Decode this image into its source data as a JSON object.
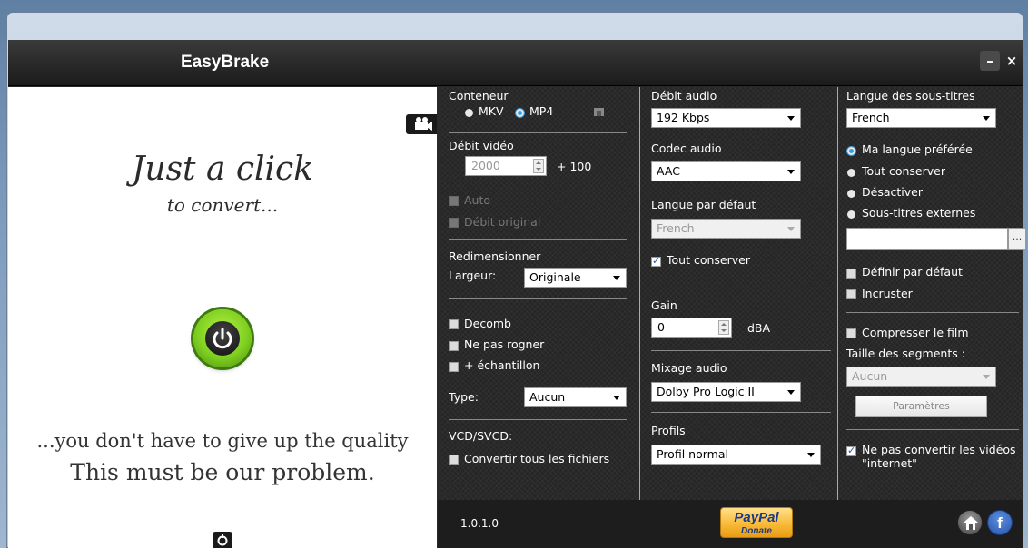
{
  "app": {
    "title": "EasyBrake",
    "minimize_label": "–",
    "close_label": "×"
  },
  "left": {
    "slogan_1": "Just a click",
    "slogan_2": "to convert...",
    "slogan_3": "...you don't have to give up the quality",
    "slogan_4": "This must be our problem."
  },
  "col1": {
    "container_label": "Conteneur",
    "container_options": [
      "MKV",
      "MP4"
    ],
    "container_selected": "MP4",
    "video_bitrate_label": "Débit vidéo",
    "video_bitrate_value": "2000",
    "video_bitrate_step": "+ 100",
    "auto_label": "Auto",
    "original_bitrate_label": "Débit original",
    "resize_label": "Redimensionner",
    "width_label": "Largeur:",
    "width_value": "Originale",
    "decomb_label": "Decomb",
    "no_crop_label": "Ne pas rogner",
    "sample_label": "+ échantillon",
    "type_label": "Type:",
    "type_value": "Aucun",
    "vcd_label": "VCD/SVCD:",
    "convert_all_label": "Convertir tous les fichiers"
  },
  "col2": {
    "audio_bitrate_label": "Débit audio",
    "audio_bitrate_value": "192 Kbps",
    "audio_codec_label": "Codec audio",
    "audio_codec_value": "AAC",
    "default_lang_label": "Langue par défaut",
    "default_lang_value": "French",
    "keep_all_label": "Tout conserver",
    "gain_label": "Gain",
    "gain_value": "0",
    "gain_unit": "dBA",
    "mixdown_label": "Mixage audio",
    "mixdown_value": "Dolby Pro Logic II",
    "profiles_label": "Profils",
    "profile_value": "Profil normal"
  },
  "col3": {
    "sub_lang_label": "Langue des sous-titres",
    "sub_lang_value": "French",
    "sub_options": [
      "Ma langue préférée",
      "Tout conserver",
      "Désactiver",
      "Sous-titres externes"
    ],
    "sub_selected": "Ma langue préférée",
    "browse_label": "...",
    "set_default_label": "Définir par défaut",
    "burn_in_label": "Incruster",
    "compress_label": "Compresser le film",
    "segment_size_label": "Taille des segments :",
    "segment_size_value": "Aucun",
    "params_label": "Paramètres",
    "no_convert_internet_label": "Ne pas convertir les vidéos \"internet\""
  },
  "footer": {
    "version": "1.0.1.0",
    "paypal_word": "PayPal",
    "paypal_sub": "Donate"
  },
  "colors": {
    "accent": "#3a9ee0",
    "power_green": "#7fd020",
    "panel_bg": "#262626"
  }
}
